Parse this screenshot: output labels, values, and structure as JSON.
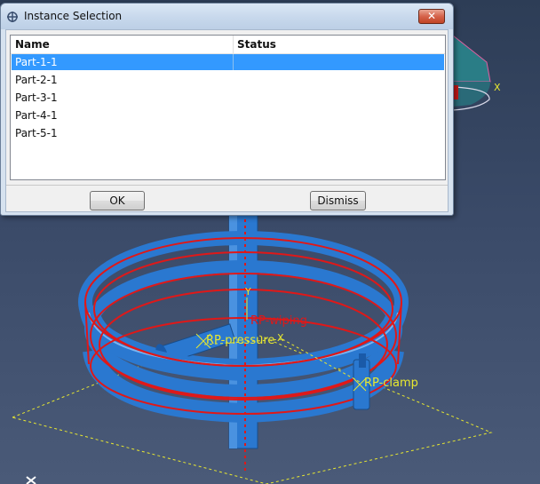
{
  "dialog": {
    "title": "Instance Selection",
    "close_label": "✕",
    "columns": {
      "name": "Name",
      "status": "Status"
    },
    "rows": [
      {
        "name": "Part-1-1",
        "status": "",
        "selected": true
      },
      {
        "name": "Part-2-1",
        "status": ""
      },
      {
        "name": "Part-3-1",
        "status": ""
      },
      {
        "name": "Part-4-1",
        "status": ""
      },
      {
        "name": "Part-5-1",
        "status": ""
      }
    ],
    "ok_label": "OK",
    "dismiss_label": "Dismiss"
  },
  "viewport": {
    "labels": {
      "rp_wiping": "RP-wiping",
      "rp_pressure": "RP-pressure",
      "rp_clamp": "RP-clamp",
      "axis_y": "Y",
      "axis_x": "X",
      "axis_x_top": "X",
      "triad_x": "X"
    },
    "colors": {
      "background": "#3a4a68",
      "part_blue": "#2a78d0",
      "mesh_red": "#e01818",
      "axis_yellow": "#e8e830",
      "selection_blue": "#3399ff"
    }
  }
}
